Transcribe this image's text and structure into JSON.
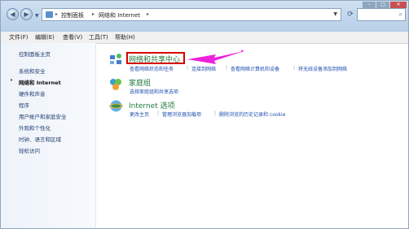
{
  "address": {
    "crumbs": [
      "控制面板",
      "网络和 Internet"
    ],
    "search_icon": "search-icon"
  },
  "menu": [
    "文件(F)",
    "编辑(E)",
    "查看(V)",
    "工具(T)",
    "帮助(H)"
  ],
  "sidebar": {
    "items": [
      {
        "label": "控制面板主页",
        "active": false
      },
      {
        "label": "系统和安全",
        "active": false
      },
      {
        "label": "网络和 Internet",
        "active": true
      },
      {
        "label": "硬件和声音",
        "active": false
      },
      {
        "label": "程序",
        "active": false
      },
      {
        "label": "用户帐户和家庭安全",
        "active": false
      },
      {
        "label": "外观和个性化",
        "active": false
      },
      {
        "label": "时钟、语言和区域",
        "active": false
      },
      {
        "label": "轻松访问",
        "active": false
      }
    ]
  },
  "categories": [
    {
      "title": "网络和共享中心",
      "links": [
        "查看网络状态和任务",
        "连接到网络",
        "查看网络计算机和设备",
        "将无线设备添加到网络"
      ]
    },
    {
      "title": "家庭组",
      "links": [
        "选择家庭组和共享选项"
      ]
    },
    {
      "title": "Internet 选项",
      "links": [
        "更改主页",
        "管理浏览器加载项",
        "删除浏览的历史记录和 cookie"
      ]
    }
  ],
  "colors": {
    "highlight_box": "#d40000",
    "annotation_arrow": "#ee22dd",
    "category_title": "#1f7a3c",
    "link": "#1f4fb0"
  }
}
